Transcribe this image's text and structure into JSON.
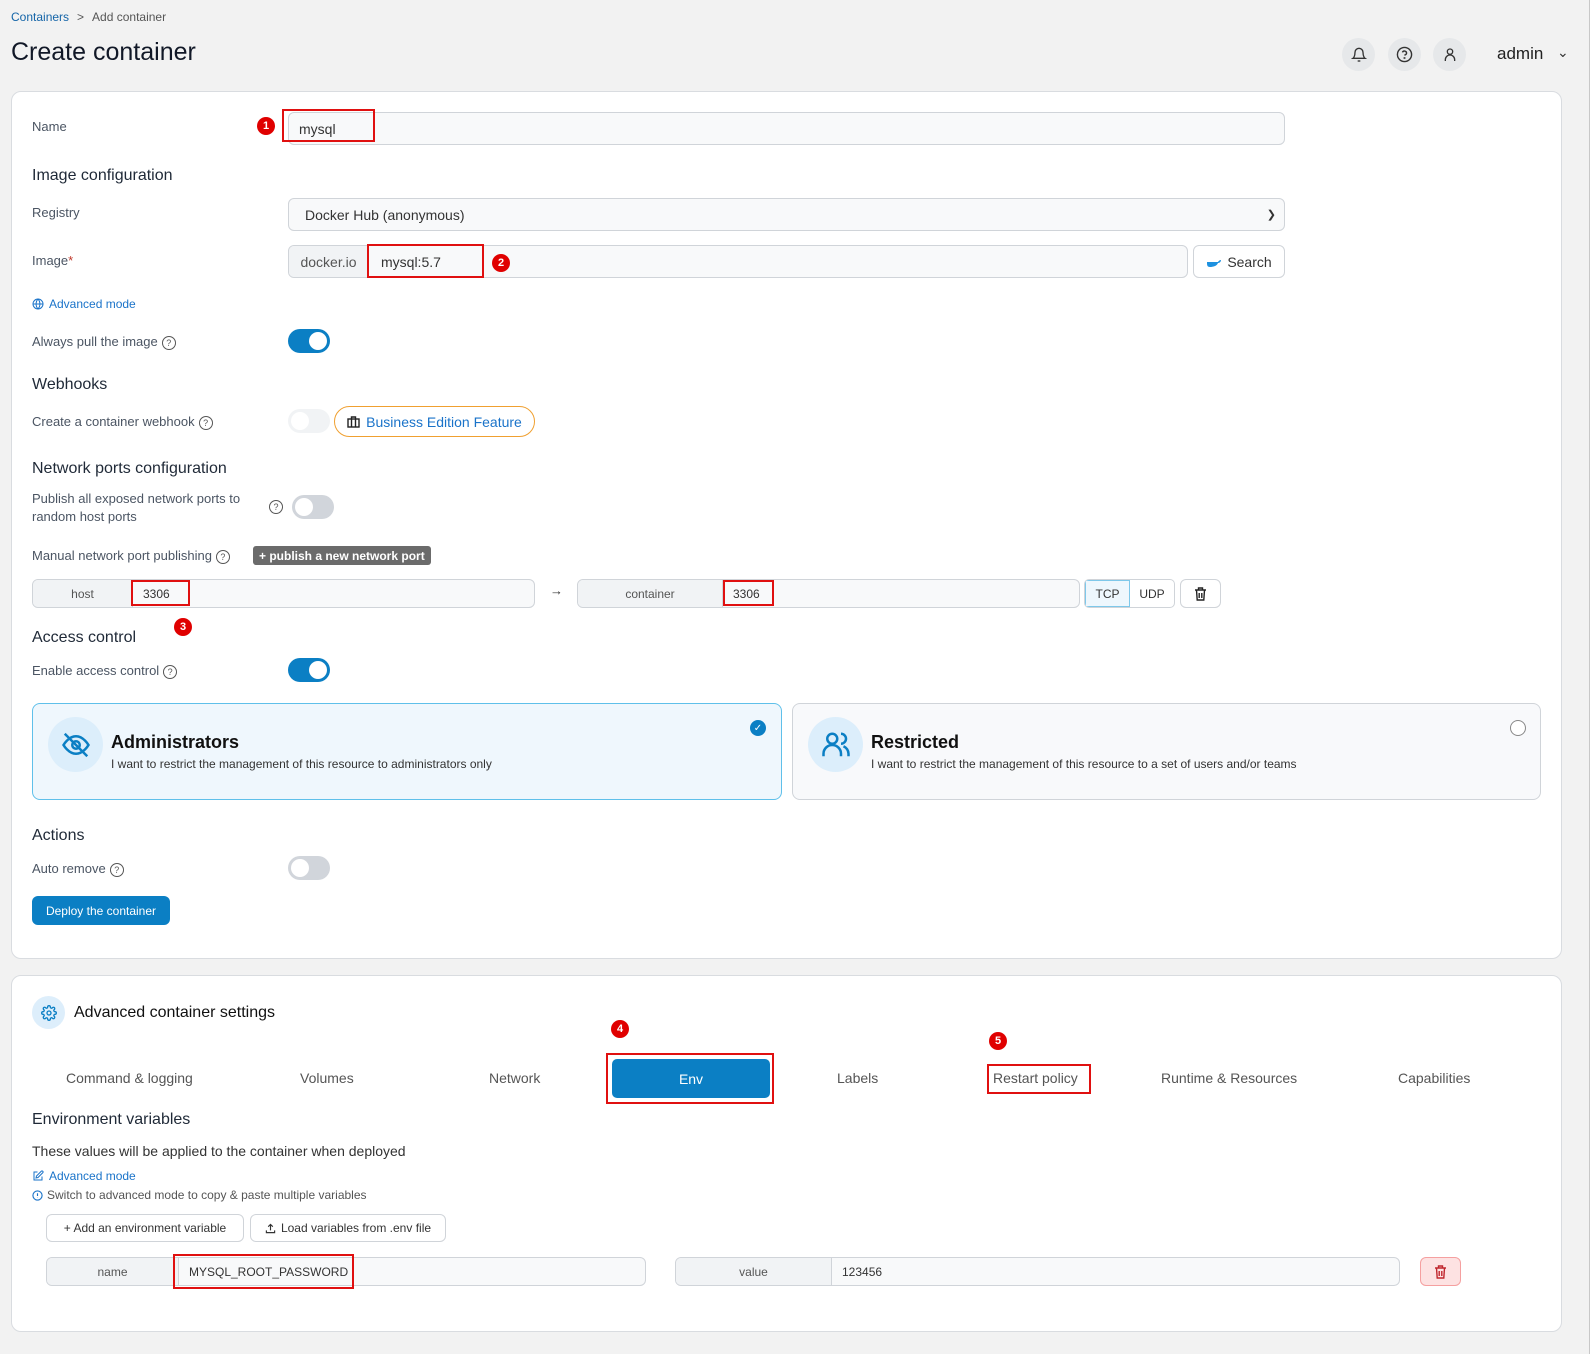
{
  "breadcrumb": {
    "root": "Containers",
    "separator": ">",
    "current": "Add container"
  },
  "page_title": "Create container",
  "header": {
    "user": "admin",
    "icons": [
      "bell-icon",
      "help-icon",
      "user-icon"
    ]
  },
  "form": {
    "name_label": "Name",
    "name_value": "mysql",
    "image_section": "Image configuration",
    "registry_label": "Registry",
    "registry_value": "Docker Hub (anonymous)",
    "image_label": "Image",
    "image_required": "*",
    "image_prefix": "docker.io",
    "image_value": "mysql:5.7",
    "search_label": "Search",
    "advanced_mode": "Advanced mode",
    "always_pull_label": "Always pull the image",
    "always_pull": true,
    "webhooks_section": "Webhooks",
    "webhook_label": "Create a container webhook",
    "webhook_enabled": false,
    "business_feature": "Business Edition Feature",
    "network_section": "Network ports configuration",
    "publish_all_label": "Publish all exposed network ports to random host ports",
    "publish_all": false,
    "manual_publish_label": "Manual network port publishing",
    "publish_new_port": "+ publish a new network port",
    "port": {
      "host_label": "host",
      "host_value": "3306",
      "container_label": "container",
      "container_value": "3306",
      "protocols": [
        "TCP",
        "UDP"
      ],
      "selected_protocol": "TCP"
    },
    "access_section": "Access control",
    "access_label": "Enable access control",
    "access_enabled": true,
    "access_options": [
      {
        "title": "Administrators",
        "desc": "I want to restrict the management of this resource to administrators only",
        "selected": true
      },
      {
        "title": "Restricted",
        "desc": "I want to restrict the management of this resource to a set of users and/or teams",
        "selected": false
      }
    ],
    "actions_section": "Actions",
    "auto_remove_label": "Auto remove",
    "auto_remove": false,
    "deploy_label": "Deploy the container"
  },
  "advanced": {
    "title": "Advanced container settings",
    "tabs": [
      "Command & logging",
      "Volumes",
      "Network",
      "Env",
      "Labels",
      "Restart policy",
      "Runtime & Resources",
      "Capabilities"
    ],
    "active_tab": "Env",
    "env": {
      "title": "Environment variables",
      "desc": "These values will be applied to the container when deployed",
      "advanced_mode": "Advanced mode",
      "hint": "Switch to advanced mode to copy & paste multiple variables",
      "add_label": "+ Add an environment variable",
      "load_label": "Load variables from .env file",
      "name_label": "name",
      "name_value": "MYSQL_ROOT_PASSWORD",
      "value_label": "value",
      "value_value": "123456"
    }
  },
  "annotations": [
    "1",
    "2",
    "3",
    "4",
    "5"
  ],
  "colors": {
    "primary": "#0b7fc4",
    "annotation": "#e00000",
    "business": "#f0a030"
  }
}
